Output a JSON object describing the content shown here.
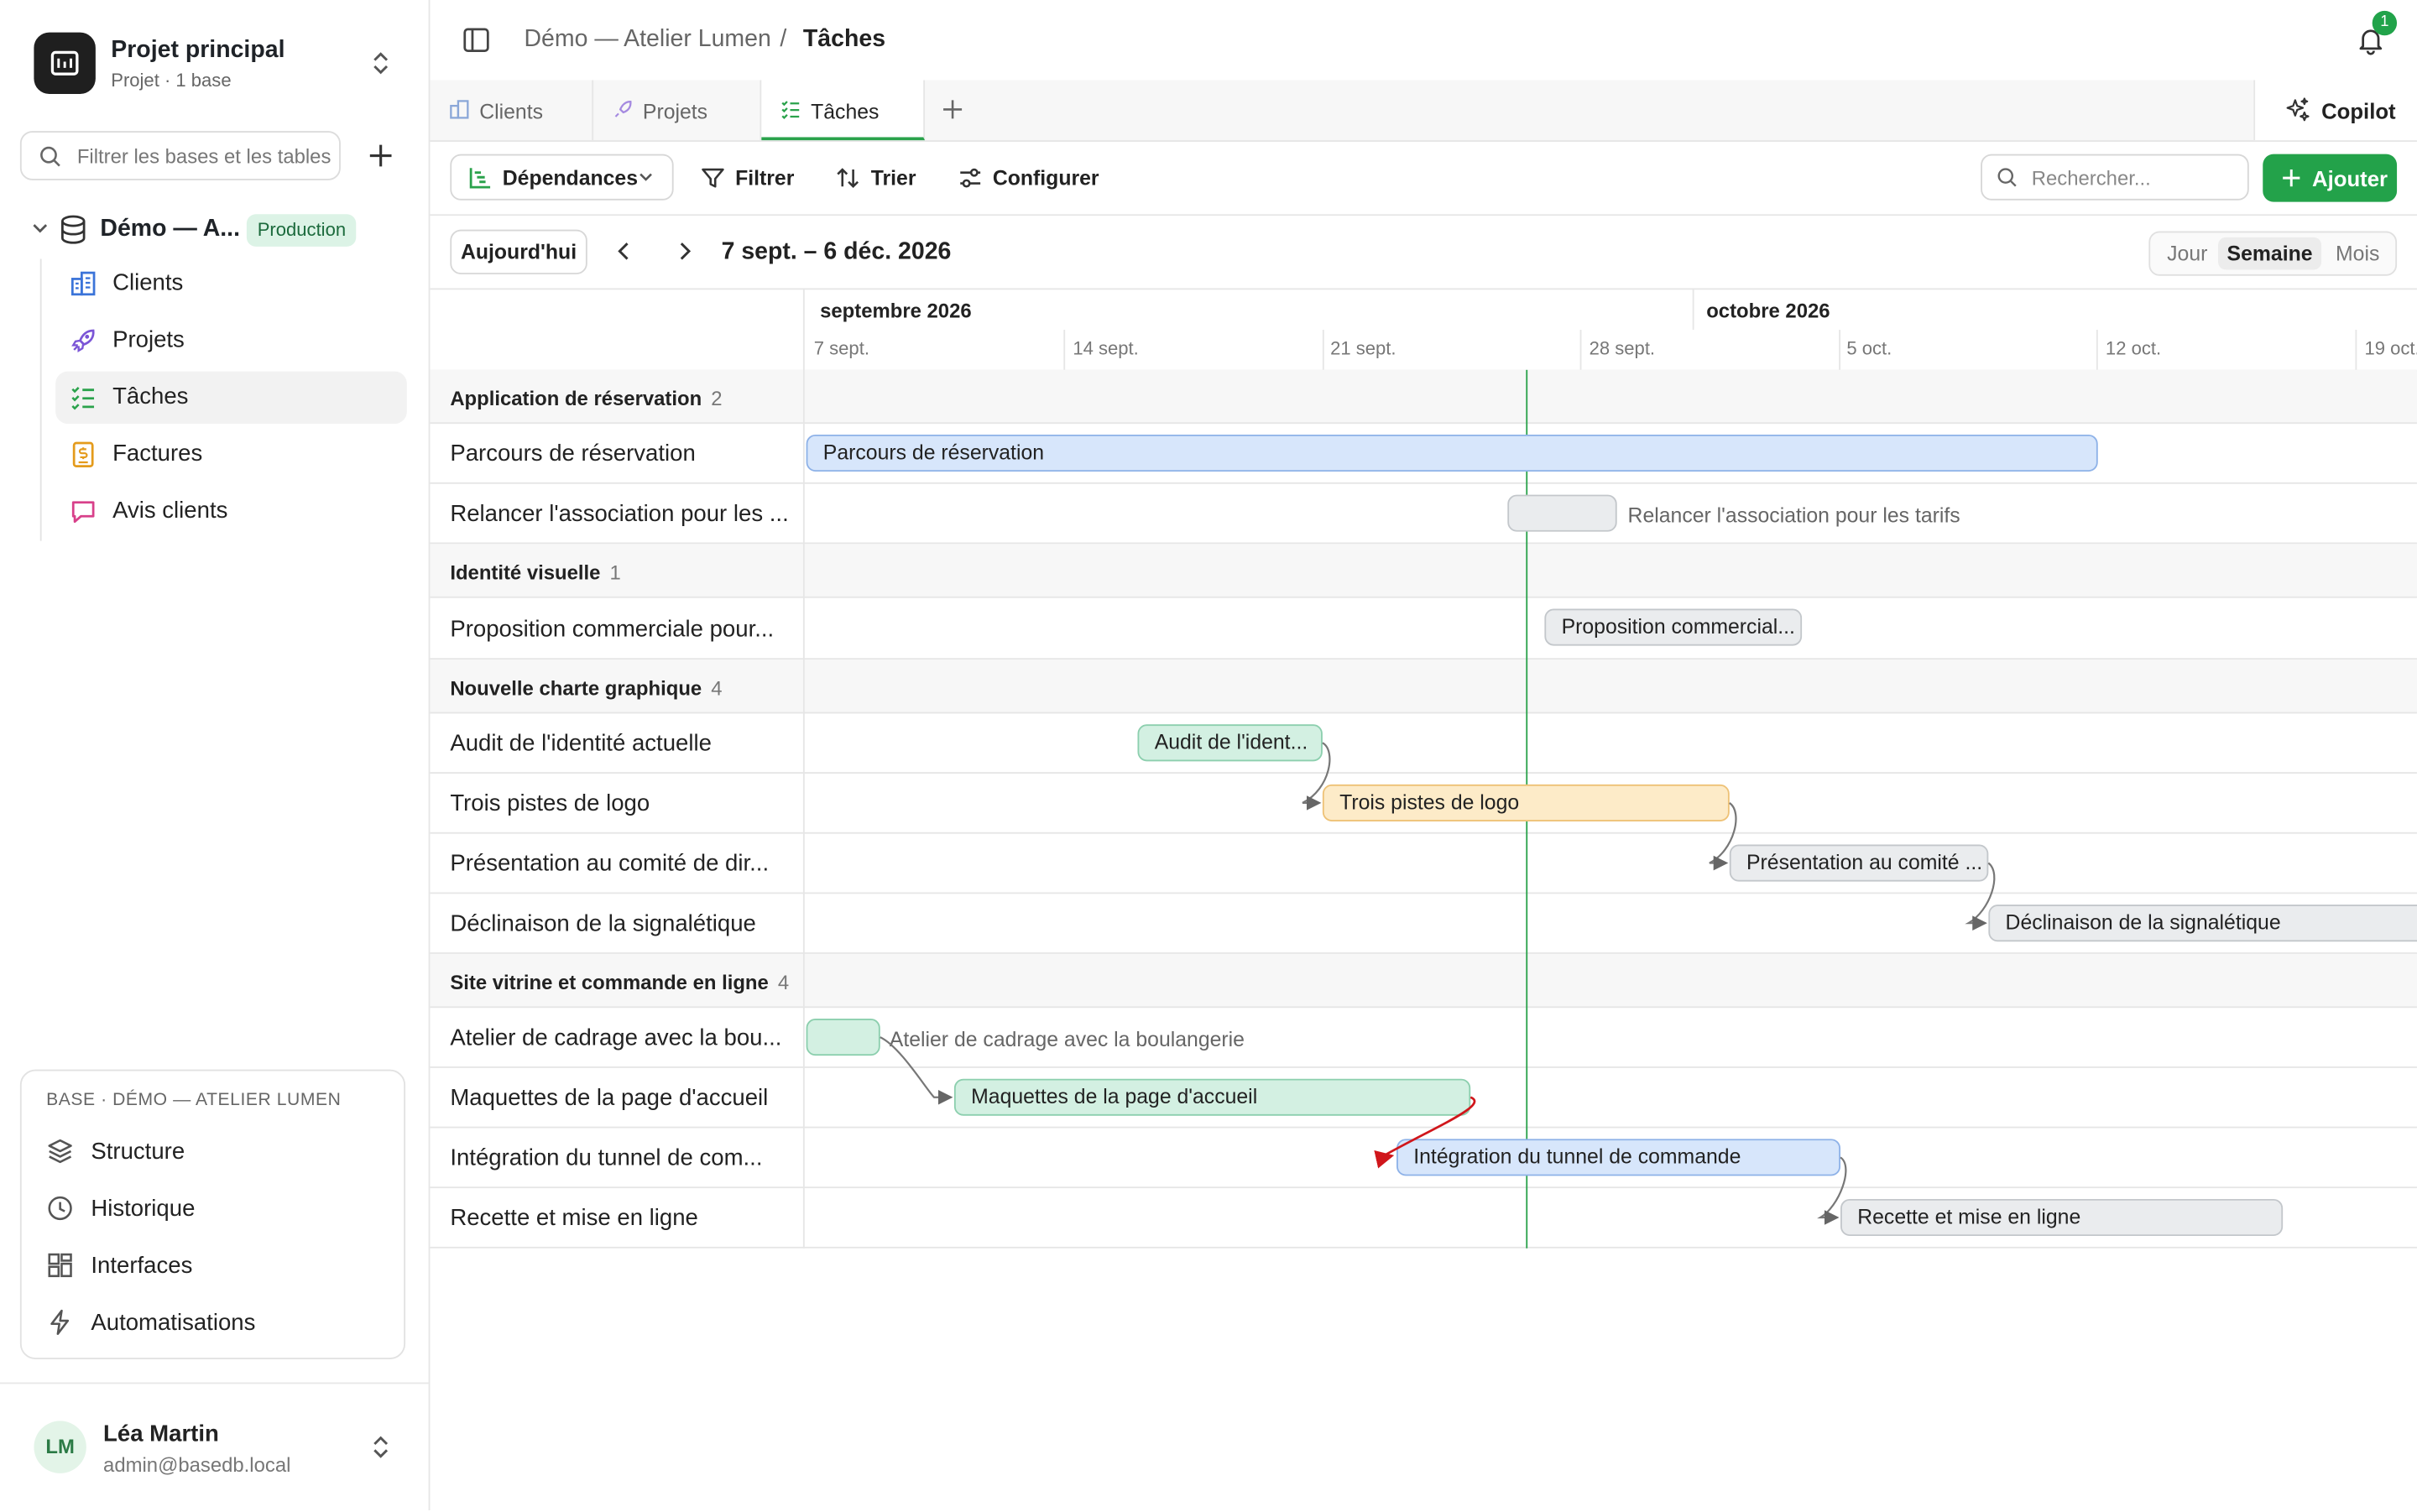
{
  "sidebar": {
    "project_title": "Projet principal",
    "project_sub": "Projet · 1 base",
    "filter_placeholder": "Filtrer les bases et les tables",
    "base_name": "Démo — A...",
    "base_badge": "Production",
    "tables": [
      {
        "label": "Clients",
        "icon": "building-icon",
        "color": "#3b74d9"
      },
      {
        "label": "Projets",
        "icon": "rocket-icon",
        "color": "#7b55d6"
      },
      {
        "label": "Tâches",
        "icon": "checklist-icon",
        "color": "#2aa24b"
      },
      {
        "label": "Factures",
        "icon": "invoice-icon",
        "color": "#e49b1c"
      },
      {
        "label": "Avis clients",
        "icon": "chat-icon",
        "color": "#d8408a"
      }
    ],
    "base_card": {
      "heading": "BASE · DÉMO — ATELIER LUMEN",
      "items": [
        {
          "label": "Structure",
          "icon": "layers-icon"
        },
        {
          "label": "Historique",
          "icon": "clock-icon"
        },
        {
          "label": "Interfaces",
          "icon": "grid-icon"
        },
        {
          "label": "Automatisations",
          "icon": "bolt-icon"
        }
      ]
    },
    "user": {
      "initials": "LM",
      "name": "Léa Martin",
      "email": "admin@basedb.local"
    }
  },
  "header": {
    "crumb_base": "Démo — Atelier Lumen",
    "crumb_sep": "/",
    "crumb_table": "Tâches",
    "notifications": "1"
  },
  "tabs": [
    {
      "label": "Clients"
    },
    {
      "label": "Projets"
    },
    {
      "label": "Tâches"
    }
  ],
  "copilot_label": "Copilot",
  "toolbar": {
    "view_label": "Dépendances",
    "filter_label": "Filtrer",
    "sort_label": "Trier",
    "config_label": "Configurer",
    "search_placeholder": "Rechercher...",
    "add_label": "Ajouter"
  },
  "datebar": {
    "today_label": "Aujourd'hui",
    "range": "7 sept. – 6 déc. 2026",
    "scale": [
      "Jour",
      "Semaine",
      "Mois"
    ],
    "scale_selected": "Semaine"
  },
  "timeline": {
    "months": [
      "septembre 2026",
      "octobre 2026"
    ],
    "weeks": [
      "7 sept.",
      "14 sept.",
      "21 sept.",
      "28 sept.",
      "5 oct.",
      "12 oct.",
      "19 oct."
    ]
  },
  "groups": [
    {
      "name": "Application de réservation",
      "count": "2",
      "tasks": [
        {
          "name": "Parcours de réservation",
          "bar_label": "Parcours de réservation",
          "color": "blue"
        },
        {
          "name": "Relancer l'association pour les ...",
          "bar_label": "Relancer l'association pour les tarifs",
          "color": "gray"
        }
      ]
    },
    {
      "name": "Identité visuelle",
      "count": "1",
      "tasks": [
        {
          "name": "Proposition commerciale pour...",
          "bar_label": "Proposition commercial...",
          "color": "gray"
        }
      ]
    },
    {
      "name": "Nouvelle charte graphique",
      "count": "4",
      "tasks": [
        {
          "name": "Audit de l'identité actuelle",
          "bar_label": "Audit de l'ident...",
          "color": "green"
        },
        {
          "name": "Trois pistes de logo",
          "bar_label": "Trois pistes de logo",
          "color": "orange"
        },
        {
          "name": "Présentation au comité de dir...",
          "bar_label": "Présentation au comité ...",
          "color": "gray"
        },
        {
          "name": "Déclinaison de la signalétique",
          "bar_label": "Déclinaison de la signalétique",
          "color": "gray"
        }
      ]
    },
    {
      "name": "Site vitrine et commande en ligne",
      "count": "4",
      "tasks": [
        {
          "name": "Atelier de cadrage avec la bou...",
          "bar_label": "Atelier de cadrage avec la boulangerie",
          "color": "green"
        },
        {
          "name": "Maquettes de la page d'accueil",
          "bar_label": "Maquettes de la page d'accueil",
          "color": "green"
        },
        {
          "name": "Intégration du tunnel de com...",
          "bar_label": "Intégration du tunnel de commande",
          "color": "blue"
        },
        {
          "name": "Recette et mise en ligne",
          "bar_label": "Recette et mise en ligne",
          "color": "gray"
        }
      ]
    }
  ]
}
